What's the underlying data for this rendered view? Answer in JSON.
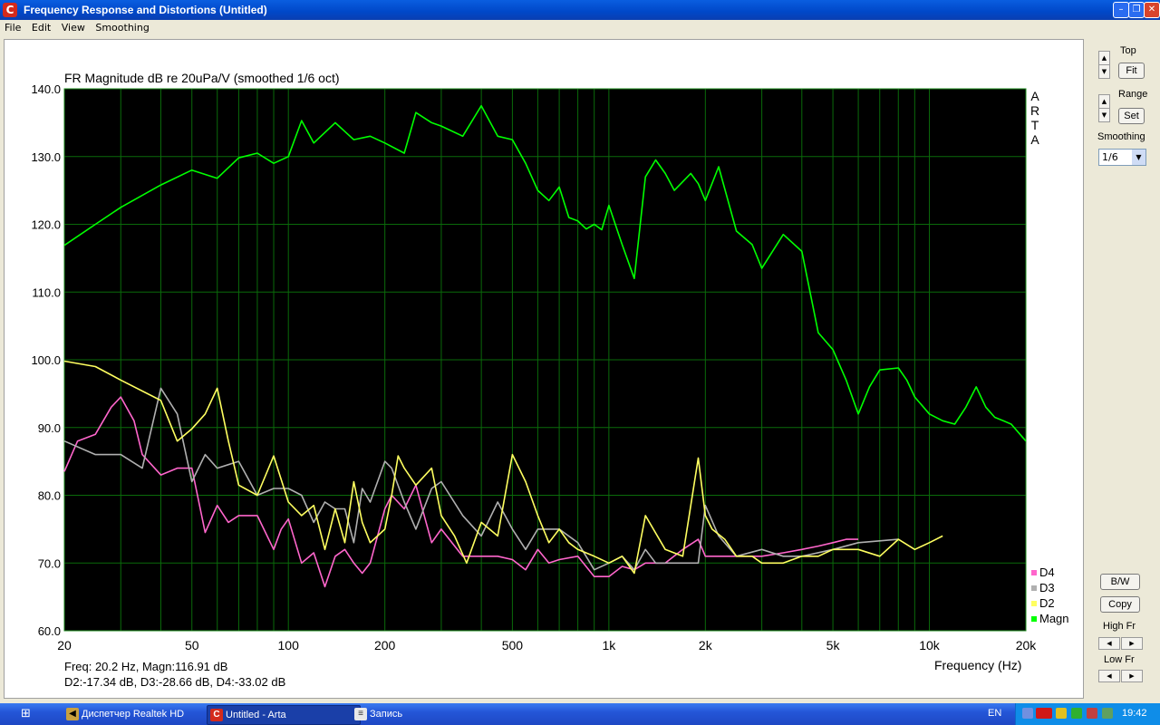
{
  "window": {
    "title": "Frequency Response and Distortions (Untitled)",
    "icon_letter": "C"
  },
  "menu": [
    "File",
    "Edit",
    "View",
    "Smoothing"
  ],
  "chart_data": {
    "type": "line",
    "title": "FR Magnitude dB re 20uPa/V (smoothed 1/6 oct)",
    "xlabel": "Frequency (Hz)",
    "xscale": "log",
    "xlim": [
      20,
      20000
    ],
    "ylim": [
      60,
      140
    ],
    "ylabel": "",
    "xtick_labels": [
      "20",
      "50",
      "100",
      "200",
      "500",
      "1k",
      "2k",
      "5k",
      "10k",
      "20k"
    ],
    "xtick_values": [
      20,
      50,
      100,
      200,
      500,
      1000,
      2000,
      5000,
      10000,
      20000
    ],
    "ytick_labels": [
      "140.0",
      "130.0",
      "120.0",
      "110.0",
      "100.0",
      "90.0",
      "80.0",
      "70.0",
      "60.0"
    ],
    "ytick_values": [
      140,
      130,
      120,
      110,
      100,
      90,
      80,
      70,
      60
    ],
    "grid": true,
    "watermark": "ARTA",
    "legend_position": "bottom-right",
    "series": [
      {
        "name": "Magn",
        "color": "#00ff00",
        "x": [
          20,
          25,
          30,
          40,
          50,
          60,
          70,
          80,
          90,
          100,
          110,
          120,
          140,
          160,
          180,
          200,
          230,
          250,
          280,
          300,
          350,
          400,
          450,
          500,
          550,
          600,
          650,
          700,
          750,
          800,
          850,
          900,
          950,
          1000,
          1100,
          1200,
          1300,
          1400,
          1500,
          1600,
          1800,
          1900,
          2000,
          2200,
          2500,
          2800,
          3000,
          3500,
          4000,
          4500,
          5000,
          5500,
          6000,
          6500,
          7000,
          8000,
          8500,
          9000,
          10000,
          11000,
          12000,
          13000,
          14000,
          15000,
          16000,
          17000,
          18000,
          20000
        ],
        "y": [
          116.9,
          120,
          122.5,
          125.8,
          128,
          126.8,
          129.8,
          130.5,
          129,
          130,
          135.3,
          132,
          135,
          132.5,
          133,
          132,
          130.5,
          136.5,
          135,
          134.5,
          133,
          137.5,
          133,
          132.5,
          129,
          125,
          123.5,
          125.5,
          121,
          120.5,
          119.3,
          120,
          119.2,
          122.8,
          117,
          112,
          127,
          129.5,
          127.5,
          125,
          127.5,
          126,
          123.5,
          128.5,
          119,
          117,
          113.5,
          118.5,
          116,
          104,
          101.5,
          97,
          92,
          96,
          98.5,
          98.8,
          97,
          94.5,
          92,
          91,
          90.5,
          93,
          96,
          93,
          91.5,
          91,
          90.5,
          88
        ]
      },
      {
        "name": "D2",
        "color": "#ffff60",
        "x": [
          20,
          25,
          30,
          40,
          45,
          50,
          55,
          60,
          65,
          70,
          80,
          90,
          100,
          110,
          120,
          130,
          140,
          150,
          160,
          170,
          180,
          200,
          210,
          220,
          230,
          250,
          280,
          300,
          330,
          360,
          400,
          450,
          500,
          550,
          600,
          650,
          700,
          750,
          800,
          900,
          1000,
          1100,
          1200,
          1300,
          1500,
          1700,
          1900,
          2000,
          2100,
          2300,
          2500,
          2800,
          3000,
          3500,
          4000,
          4500,
          5000,
          6000,
          7000,
          8000,
          9000,
          10000,
          11000
        ],
        "y": [
          99.8,
          99,
          97,
          94,
          88,
          89.8,
          92,
          95.8,
          88,
          81.5,
          80,
          85.8,
          79,
          77,
          78.5,
          72,
          78,
          73,
          82,
          76,
          73,
          75,
          80,
          85.8,
          84,
          81.5,
          84,
          77,
          74,
          70,
          76,
          74,
          86,
          82,
          77,
          73,
          75,
          73,
          72,
          71,
          70,
          71,
          68.5,
          77,
          72,
          71,
          85.5,
          77,
          75,
          73.5,
          71,
          71,
          70,
          70,
          71,
          71,
          72,
          72,
          71,
          73.5,
          72,
          73,
          74
        ]
      },
      {
        "name": "D3",
        "color": "#b0b0b0",
        "x": [
          20,
          25,
          30,
          35,
          40,
          45,
          50,
          55,
          60,
          70,
          80,
          90,
          100,
          110,
          120,
          130,
          140,
          150,
          160,
          170,
          180,
          200,
          210,
          230,
          250,
          280,
          300,
          350,
          400,
          450,
          500,
          550,
          600,
          650,
          700,
          800,
          900,
          1000,
          1100,
          1200,
          1300,
          1400,
          1500,
          1700,
          1900,
          2000,
          2200,
          2500,
          3000,
          3500,
          4000,
          5000,
          6000,
          8000
        ],
        "y": [
          88,
          86,
          86,
          84,
          95.8,
          92,
          82,
          86,
          84,
          85,
          80,
          81,
          81,
          80,
          76,
          79,
          78,
          78,
          73,
          81,
          79,
          85,
          84,
          79,
          75,
          81,
          82,
          77,
          74,
          79,
          75,
          72,
          75,
          75,
          75,
          73,
          69,
          70,
          71,
          69,
          72,
          70,
          70,
          70,
          70,
          78.5,
          74,
          71,
          72,
          71,
          71,
          72,
          73,
          73.5
        ]
      },
      {
        "name": "D4",
        "color": "#ff66cc",
        "x": [
          20,
          22,
          25,
          28,
          30,
          33,
          35,
          40,
          45,
          50,
          55,
          60,
          65,
          70,
          80,
          90,
          95,
          100,
          110,
          120,
          130,
          140,
          150,
          160,
          170,
          180,
          200,
          210,
          230,
          250,
          280,
          300,
          350,
          400,
          450,
          500,
          550,
          600,
          650,
          700,
          800,
          900,
          1000,
          1100,
          1200,
          1300,
          1400,
          1500,
          1700,
          1900,
          2000,
          2200,
          2500,
          3000,
          3500,
          4000,
          4500,
          5000,
          5500,
          6000
        ],
        "y": [
          83.5,
          88,
          89,
          93,
          94.5,
          91,
          86,
          83,
          84,
          84,
          74.5,
          78.5,
          76,
          77,
          77,
          72,
          75,
          76.5,
          70,
          71.5,
          66.5,
          71,
          72,
          70,
          68.5,
          70,
          78,
          80,
          78,
          81.5,
          73,
          75,
          71,
          71,
          71,
          70.5,
          69,
          72,
          70,
          70.5,
          71,
          68,
          68,
          69.5,
          69,
          70,
          70,
          70,
          72,
          73.5,
          71,
          71,
          71,
          71,
          71.5,
          72,
          72.5,
          73,
          73.5,
          73.5
        ]
      }
    ],
    "readout": {
      "line1": "Freq: 20.2 Hz, Magn:116.91 dB",
      "line2": "D2:-17.34 dB, D3:-28.66 dB, D4:-33.02 dB"
    }
  },
  "side_panel": {
    "top_label": "Top",
    "fit_label": "Fit",
    "range_label": "Range",
    "set_label": "Set",
    "smoothing_label": "Smoothing",
    "smoothing_value": "1/6",
    "bw_label": "B/W",
    "copy_label": "Copy",
    "high_fr_label": "High Fr",
    "low_fr_label": "Low Fr"
  },
  "taskbar": {
    "items": [
      {
        "label": "Диспетчер Realtek HD",
        "icon": "speaker-icon"
      },
      {
        "label": "Untitled - Arta",
        "icon": "arta-app-icon",
        "active": true
      },
      {
        "label": "Запись",
        "icon": "document-icon"
      }
    ],
    "language": "EN",
    "clock": "19:42"
  }
}
